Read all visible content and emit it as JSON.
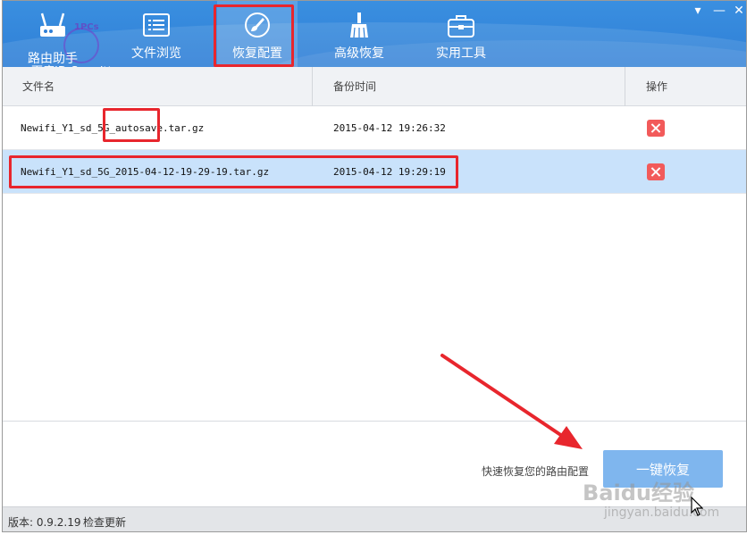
{
  "window": {
    "minimize_glyph": "▾",
    "maximize_glyph": "—",
    "close_glyph": "✕"
  },
  "logo": {
    "app_name": "路由助手",
    "watermark_circle_text": "1PCs",
    "watermark_id": "百度ID:Sanpitt"
  },
  "tabs": [
    {
      "label": "文件浏览",
      "icon": "list-icon",
      "active": false
    },
    {
      "label": "恢复配置",
      "icon": "brush-icon",
      "active": true
    },
    {
      "label": "高级恢复",
      "icon": "broom-icon",
      "active": false
    },
    {
      "label": "实用工具",
      "icon": "toolbox-icon",
      "active": false
    }
  ],
  "table": {
    "headers": [
      "文件名",
      "备份时间",
      "操作"
    ],
    "rows": [
      {
        "filename": "Newifi_Y1_sd_5G_autosave.tar.gz",
        "time": "2015-04-12 19:26:32",
        "action_icon": "delete-icon",
        "selected": false
      },
      {
        "filename": "Newifi_Y1_sd_5G_2015-04-12-19-29-19.tar.gz",
        "time": "2015-04-12 19:29:19",
        "action_icon": "delete-icon",
        "selected": true
      }
    ]
  },
  "bottom": {
    "hint": "快速恢复您的路由配置",
    "restore_button": "一键恢复"
  },
  "status": {
    "version": "版本: 0.9.2.19",
    "check_update": "检查更新"
  },
  "watermark": {
    "brand": "Baidu经验",
    "url": "jingyan.baidu.com"
  },
  "colors": {
    "header_blue": "#3a8fe0",
    "selected_row": "#c9e2fb",
    "delete_red": "#f25a5a",
    "button_blue": "#7fb6ee",
    "annotation_red": "#e8262d"
  }
}
